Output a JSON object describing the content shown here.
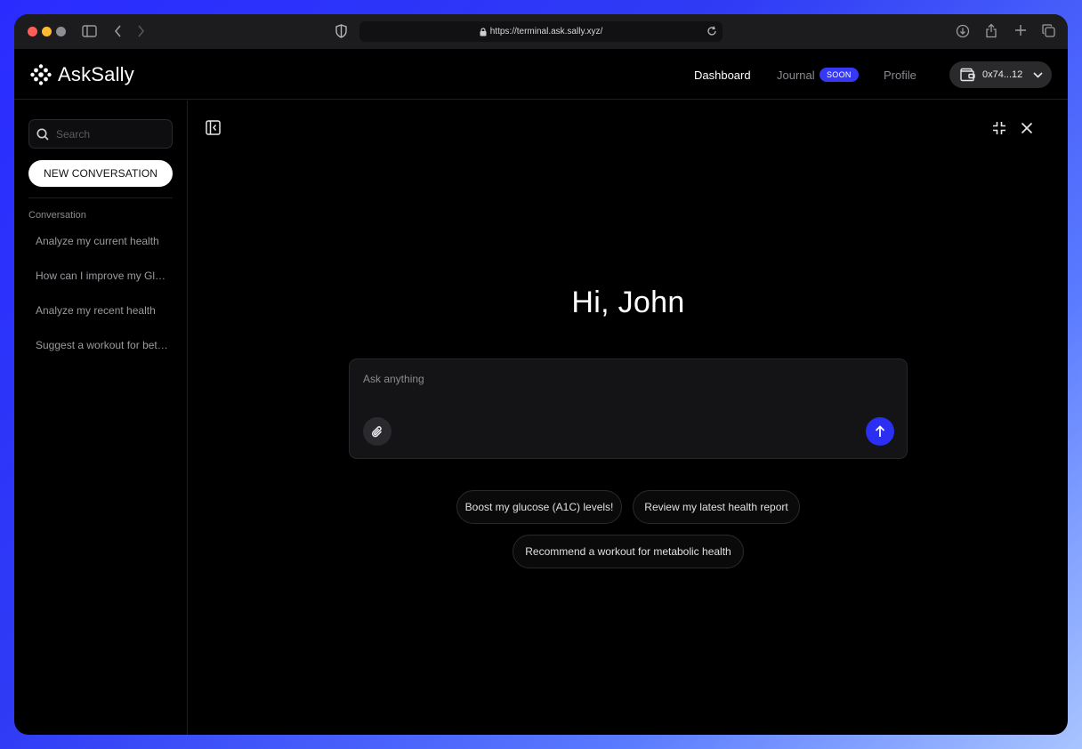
{
  "browser": {
    "url": "https://terminal.ask.sally.xyz/",
    "traffic_lights": [
      "#ff5f57",
      "#febc2e",
      "#8e8e93"
    ]
  },
  "header": {
    "logo_text": "AskSally",
    "nav": {
      "dashboard": "Dashboard",
      "journal": "Journal",
      "journal_badge": "SOON",
      "profile": "Profile"
    },
    "wallet_label": "0x74...12"
  },
  "sidebar": {
    "search_placeholder": "Search",
    "new_conversation_label": "NEW CONVERSATION",
    "section_label": "Conversation",
    "conversations": [
      "Analyze my current health",
      "How can I improve my Glucose",
      "Analyze my recent health",
      "Suggest a workout for better"
    ]
  },
  "main": {
    "greeting": "Hi, John",
    "composer_placeholder": "Ask anything",
    "suggestions": [
      "Boost my glucose (A1C) levels!",
      "Review my latest health report",
      "Recommend a workout for metabolic health"
    ]
  },
  "colors": {
    "accent": "#2b2ff2",
    "badge": "#3638f5",
    "background": "#000000"
  }
}
